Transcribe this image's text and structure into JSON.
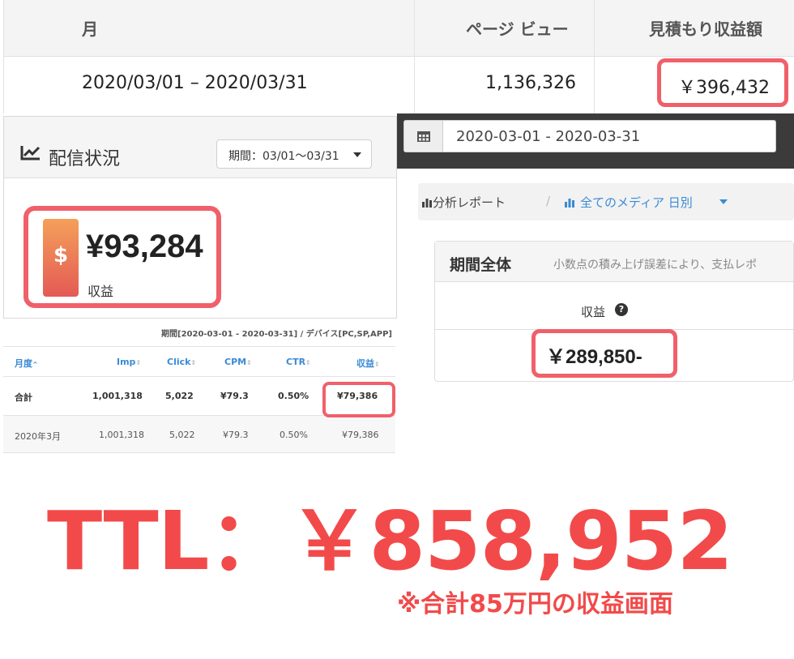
{
  "top_table": {
    "headers": [
      "月",
      "ページ ビュー",
      "見積もり収益額"
    ],
    "row": {
      "period": "2020/03/01 – 2020/03/31",
      "page_views": "1,136,326",
      "revenue": "￥396,432"
    }
  },
  "haishin": {
    "title": "配信状況",
    "period_select": "期間：03/01～03/31",
    "icon": "$",
    "amount": "¥93,284",
    "label": "収益"
  },
  "analysis": {
    "date_range": "2020-03-01 - 2020-03-31",
    "breadcrumb": [
      "分析レポート",
      "/",
      "全てのメディア 日別"
    ],
    "card_title": "期間全体",
    "card_note": "小数点の積み上げ誤差により、支払レポ",
    "revenue_label": "収益",
    "help_icon": "?",
    "amount": "￥289,850-"
  },
  "small_table": {
    "meta": "期間[2020-03-01 - 2020-03-31] / デバイス[PC,SP,APP]",
    "columns": [
      "月度",
      "Imp",
      "Click",
      "CPM",
      "CTR",
      "収益"
    ],
    "total_row": [
      "合計",
      "1,001,318",
      "5,022",
      "¥79.3",
      "0.50%",
      "¥79,386"
    ],
    "month_row": [
      "2020年3月",
      "1,001,318",
      "5,022",
      "¥79.3",
      "0.50%",
      "¥79,386"
    ]
  },
  "total": {
    "text": "TTL：￥858,952",
    "note": "※合計85万円の収益画面"
  },
  "colors": {
    "highlight": "#f0606a",
    "total_text": "#f24a4a",
    "link_blue": "#3a8ad6"
  }
}
